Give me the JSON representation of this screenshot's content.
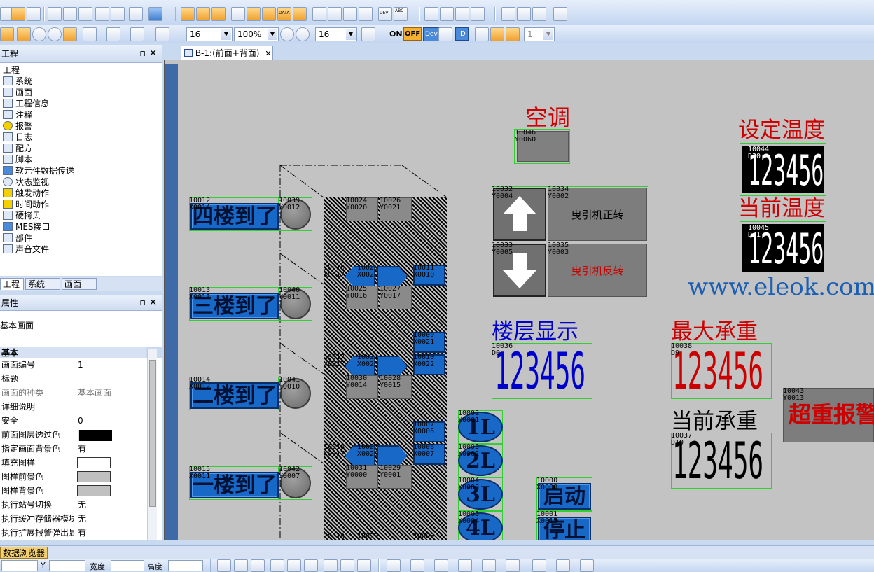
{
  "toolbar": {
    "font_size_1": "16",
    "zoom": "100%",
    "font_size_2": "16",
    "on_label": "ON",
    "off_label": "OFF",
    "dev_label": "Dev",
    "id_label": "ID",
    "combo_1": "1",
    "dev_small": "DEV",
    "abc_small": "ABC",
    "data_small": "DATA"
  },
  "project_panel": {
    "title": "工程",
    "pin": "⊓",
    "close": "✕",
    "root": "工程",
    "items": [
      "系统",
      "画面",
      "工程信息",
      "注释",
      "报警",
      "日志",
      "配方",
      "脚本",
      "软元件数据传送",
      "状态监视",
      "触发动作",
      "时间动作",
      "硬拷贝",
      "MES接口",
      "部件",
      "声音文件"
    ],
    "tabs": [
      "工程",
      "系统",
      "画面"
    ]
  },
  "props_panel": {
    "title": "属性",
    "subject": "基本画面",
    "section": "基本",
    "rows": [
      {
        "k": "画面编号",
        "v": "1"
      },
      {
        "k": "标题",
        "v": ""
      },
      {
        "k": "画面的种类",
        "v": "基本画面"
      },
      {
        "k": "详细说明",
        "v": ""
      },
      {
        "k": "安全",
        "v": "0"
      },
      {
        "k": "前面图层透过色",
        "v": ""
      },
      {
        "k": "指定画面背景色",
        "v": "有"
      },
      {
        "k": "填充图样",
        "v": ""
      },
      {
        "k": "图样前景色",
        "v": ""
      },
      {
        "k": "图样背景色",
        "v": ""
      },
      {
        "k": "执行站号切换",
        "v": "无"
      },
      {
        "k": "执行缓冲存储器模块",
        "v": "无"
      },
      {
        "k": "执行扩展报警弹出显",
        "v": "有"
      }
    ]
  },
  "doc_tab": {
    "label": "B-1:(前面+背面)",
    "close": "✕"
  },
  "screen": {
    "aircon_title": "空调",
    "aircon_lbl": "10046\nY0060",
    "set_temp_title": "设定温度",
    "cur_temp_title": "当前温度",
    "set_temp_lbl": "10044\nD30",
    "cur_temp_lbl": "10045\nD31",
    "temp_value": "123456",
    "watermark": "www.eleok.com",
    "floors": [
      {
        "text": "四楼到了",
        "lbl": "10012\nX0014",
        "lamp_lbl": "10039\nY0012"
      },
      {
        "text": "三楼到了",
        "lbl": "10013\nX0013",
        "lamp_lbl": "10040\nY0011"
      },
      {
        "text": "二楼到了",
        "lbl": "10014\nX0012",
        "lamp_lbl": "10041\nY0010"
      },
      {
        "text": "一楼到了",
        "lbl": "10015\nX0011",
        "lamp_lbl": "10042\nY0007"
      }
    ],
    "shaft_labels": [
      "10024\nY0020",
      "10026\nY0021",
      "10016\nX0017",
      "10020\nX0020",
      "10011\nX0010",
      "10025\nY0016",
      "10027\nY0017",
      "10009\nX0021",
      "10017\nX0017",
      "10021\nX0020",
      "10010\nX0022",
      "10030\nY0014",
      "10028\nY0015",
      "10007\nX0006",
      "10018\nX0017",
      "10022\nX0020",
      "10008\nX0007",
      "10031\nY0000",
      "10029\nY0001",
      "10019",
      "10023",
      "10005"
    ],
    "traction_up_lbl": "10032\nY0004",
    "traction_up_text_lbl": "10034\nY0002",
    "traction_up_text": "曳引机正转",
    "traction_down_lbl": "10033\nY0005",
    "traction_down_text_lbl": "10035\nY0003",
    "traction_down_text": "曳引机反转",
    "floor_display_title": "楼层显示",
    "floor_display_lbl": "10036\nD0",
    "max_load_title": "最大承重",
    "max_load_lbl": "10038\nD9",
    "cur_load_title": "当前承重",
    "cur_load_lbl": "10037\nD10",
    "overload_lbl": "10043\nY0013",
    "overload_text": "超重报警",
    "call_buttons": [
      {
        "text": "1L",
        "lbl": "10002\nX0001"
      },
      {
        "text": "2L",
        "lbl": "10003\nX0002"
      },
      {
        "text": "3L",
        "lbl": "10004\nX0003"
      },
      {
        "text": "4L",
        "lbl": "10005\nX0004"
      }
    ],
    "start_lbl": "10000\nX0000",
    "start_text": "启动",
    "stop_lbl": "10001\nX0015",
    "stop_text": "停止"
  },
  "bottom": {
    "data_browser_tab": "数据浏览器",
    "y_label": "Y",
    "width_label": "宽度",
    "height_label": "高度"
  },
  "colors": {
    "canvas_bg": "#c3c3c3",
    "button_blue": "#1868c8",
    "title_red": "#cc0000",
    "title_blue": "#0000cc",
    "watermark_blue": "#1a5fb4"
  }
}
